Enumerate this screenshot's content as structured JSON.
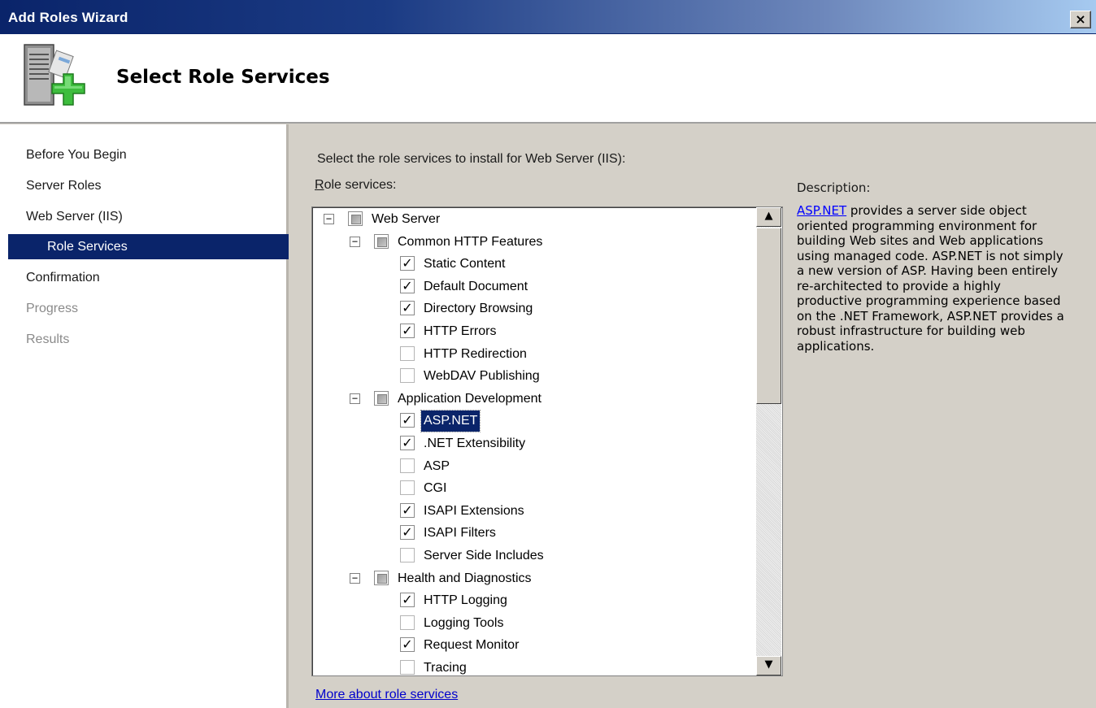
{
  "window": {
    "title": "Add Roles Wizard",
    "close_label": "×"
  },
  "header": {
    "title": "Select Role Services",
    "icon": "server-roles-add-icon"
  },
  "sidebar": {
    "items": [
      {
        "label": "Before You Begin",
        "state": "normal"
      },
      {
        "label": "Server Roles",
        "state": "normal"
      },
      {
        "label": "Web Server (IIS)",
        "state": "normal"
      },
      {
        "label": "Role Services",
        "state": "selected"
      },
      {
        "label": "Confirmation",
        "state": "normal"
      },
      {
        "label": "Progress",
        "state": "disabled"
      },
      {
        "label": "Results",
        "state": "disabled"
      }
    ]
  },
  "main": {
    "instructions": "Select the role services to install for Web Server (IIS):",
    "role_services_label_first": "R",
    "role_services_label_rest": "ole services:",
    "tree": [
      {
        "label": "Web Server",
        "level": 0,
        "expander": "⊟",
        "check": "partial"
      },
      {
        "label": "Common HTTP Features",
        "level": 1,
        "expander": "⊟",
        "check": "partial"
      },
      {
        "label": "Static Content",
        "level": 2,
        "check": "checked"
      },
      {
        "label": "Default Document",
        "level": 2,
        "check": "checked"
      },
      {
        "label": "Directory Browsing",
        "level": 2,
        "check": "checked"
      },
      {
        "label": "HTTP Errors",
        "level": 2,
        "check": "checked"
      },
      {
        "label": "HTTP Redirection",
        "level": 2,
        "check": "unchecked"
      },
      {
        "label": "WebDAV Publishing",
        "level": 2,
        "check": "unchecked"
      },
      {
        "label": "Application Development",
        "level": 1,
        "expander": "⊟",
        "check": "partial"
      },
      {
        "label": "ASP.NET",
        "level": 2,
        "check": "checked",
        "selected": true
      },
      {
        "label": ".NET Extensibility",
        "level": 2,
        "check": "checked"
      },
      {
        "label": "ASP",
        "level": 2,
        "check": "unchecked"
      },
      {
        "label": "CGI",
        "level": 2,
        "check": "unchecked"
      },
      {
        "label": "ISAPI Extensions",
        "level": 2,
        "check": "checked"
      },
      {
        "label": "ISAPI Filters",
        "level": 2,
        "check": "checked"
      },
      {
        "label": "Server Side Includes",
        "level": 2,
        "check": "unchecked"
      },
      {
        "label": "Health and Diagnostics",
        "level": 1,
        "expander": "⊟",
        "check": "partial"
      },
      {
        "label": "HTTP Logging",
        "level": 2,
        "check": "checked"
      },
      {
        "label": "Logging Tools",
        "level": 2,
        "check": "unchecked"
      },
      {
        "label": "Request Monitor",
        "level": 2,
        "check": "checked"
      },
      {
        "label": "Tracing",
        "level": 2,
        "check": "unchecked"
      }
    ],
    "scroll_up": "▲",
    "scroll_down": "▼",
    "description_label": "Description:",
    "description_link": "ASP.NET",
    "description_body": " provides a server side object oriented programming environment for building Web sites and Web applications using managed code. ASP.NET is not simply a new version of ASP. Having been entirely re-architected to provide a highly productive programming experience based on the .NET Framework, ASP.NET provides a robust infrastructure for building web applications.",
    "more_link": "More about role services"
  },
  "colors": {
    "titlebar_start": "#0a246a",
    "selection": "#0a246a",
    "link": "#0000ff",
    "dialog_bg": "#d4d0c8"
  }
}
